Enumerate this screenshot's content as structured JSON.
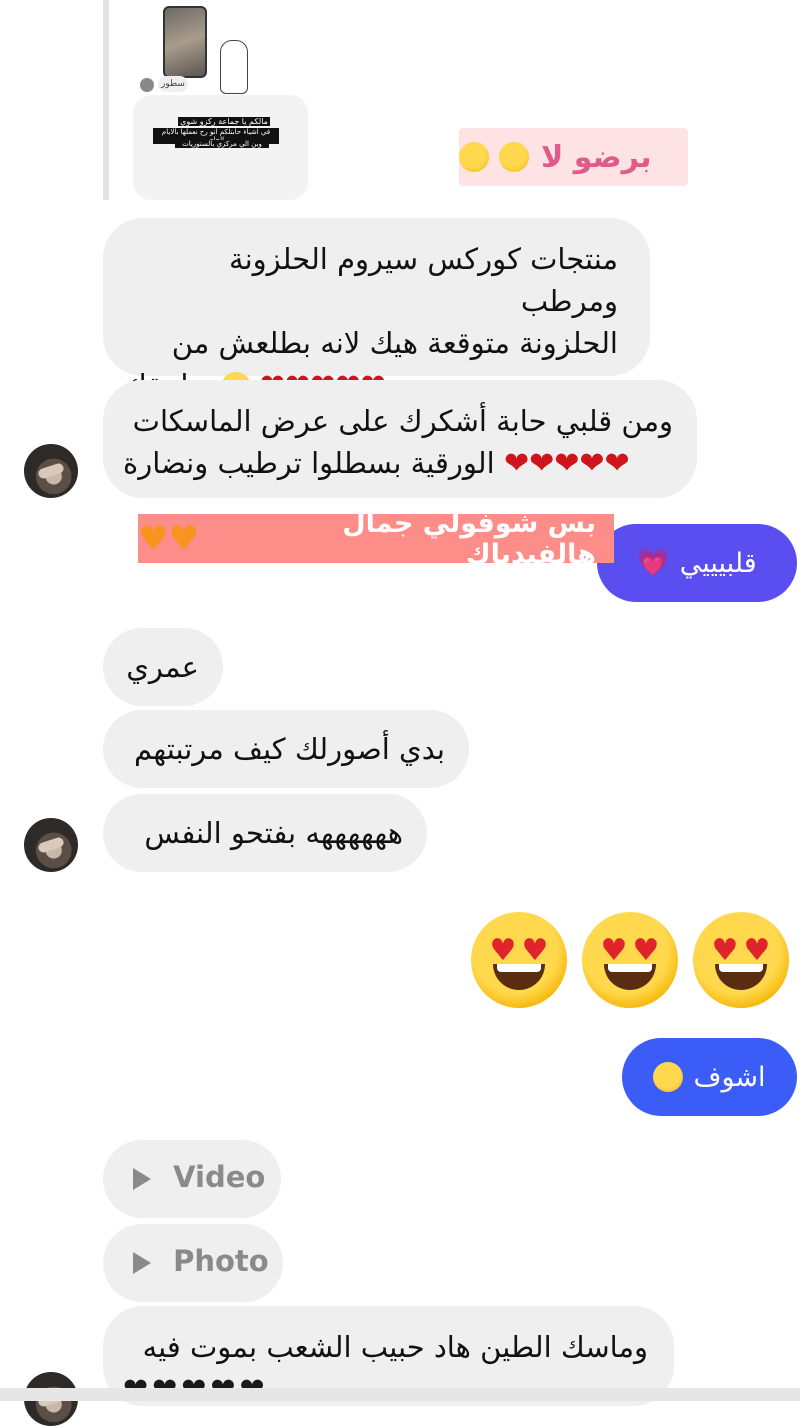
{
  "shared_story": {
    "sender_label": "سطور",
    "caption_title": "مالكم يا جماعة ركزو شوي",
    "caption_line2": "في اشياء حابتلكم انو رح نعملها بالايام الجاي",
    "caption_line3": "وبن الي مركزي بالستوريات",
    "reaction_text": "برضو لا"
  },
  "messages": {
    "m1_line1": "منتجات كوركس سيروم الحلزونة ومرطب",
    "m1_line2": "الحلزونة متوقعة هيك لانه بطلعش من",
    "m1_line3": "تطبيقك",
    "m2_line1": "ومن قلبي حابة أشكرك على عرض الماسكات",
    "m2_line2": "الورقية بسطلوا ترطيب ونضارة",
    "overlay_caption": "بس شوفولي جمال هالفيدباك",
    "sent_heart_text": "قلبيييي",
    "m3": "عمري",
    "m4": "بدي أصورلك كيف مرتبتهم",
    "m5": "ههههههه بفتحو النفس",
    "sent_look_text": "اشوف",
    "video_label": "Video",
    "photo_label": "Photo",
    "m6_line1": "وماسك الطين هاد حبيب الشعب بموت فيه"
  },
  "icons": {
    "red_hearts": "❤❤❤❤❤",
    "black_hearts": "❤❤❤❤❤",
    "orange_hearts": "♥♥",
    "pink_heart": "💗"
  },
  "colors": {
    "incoming_bubble": "#efefef",
    "outgoing_purple": "#5b4ef0",
    "outgoing_blue": "#3b5cf6",
    "caption_bg": "#fd8d88",
    "reaction_bg": "#fde3e3"
  }
}
